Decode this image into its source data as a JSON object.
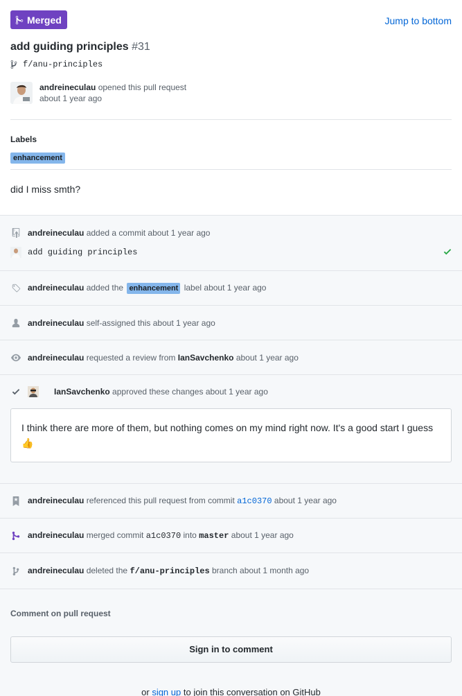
{
  "header": {
    "badge": "Merged",
    "jump": "Jump to bottom",
    "title": "add guiding principles",
    "number": "#31",
    "branch": "f/anu-principles",
    "opener_name": "andreineculau",
    "opener_action": "opened this pull request",
    "opener_time": "about 1 year ago",
    "labels_title": "Labels",
    "label": "enhancement",
    "body": "did I miss smth?"
  },
  "timeline": {
    "commit_actor": "andreineculau",
    "commit_action": "added a commit about 1 year ago",
    "commit_message": "add guiding principles",
    "label_actor": "andreineculau",
    "label_pre": "added the",
    "label_name": "enhancement",
    "label_post": "label about 1 year ago",
    "assign_actor": "andreineculau",
    "assign_action": "self-assigned this about 1 year ago",
    "review_req_actor": "andreineculau",
    "review_req_action": "requested a review from",
    "review_req_target": "IanSavchenko",
    "review_req_time": "about 1 year ago",
    "approve_actor": "IanSavchenko",
    "approve_action": "approved these changes about 1 year ago",
    "review_text": "I think there are more of them, but nothing comes on my mind right now. It's a good start I guess",
    "review_emoji": "👍",
    "ref_actor": "andreineculau",
    "ref_action": "referenced this pull request from commit",
    "ref_sha": "a1c0370",
    "ref_time": "about 1 year ago",
    "merge_actor": "andreineculau",
    "merge_action": "merged commit",
    "merge_sha": "a1c0370",
    "merge_into": "into",
    "merge_branch": "master",
    "merge_time": "about 1 year ago",
    "delete_actor": "andreineculau",
    "delete_pre": "deleted the",
    "delete_branch": "f/anu-principles",
    "delete_post": "branch about 1 month ago"
  },
  "footer": {
    "comment_title": "Comment on pull request",
    "signin": "Sign in to comment",
    "signup_pre": "or",
    "signup_link": "sign up",
    "signup_post": "to join this conversation on GitHub"
  },
  "colors": {
    "merged": "#6f42c1",
    "link": "#0366d6",
    "label": "#84b6eb",
    "check": "#28a745"
  }
}
